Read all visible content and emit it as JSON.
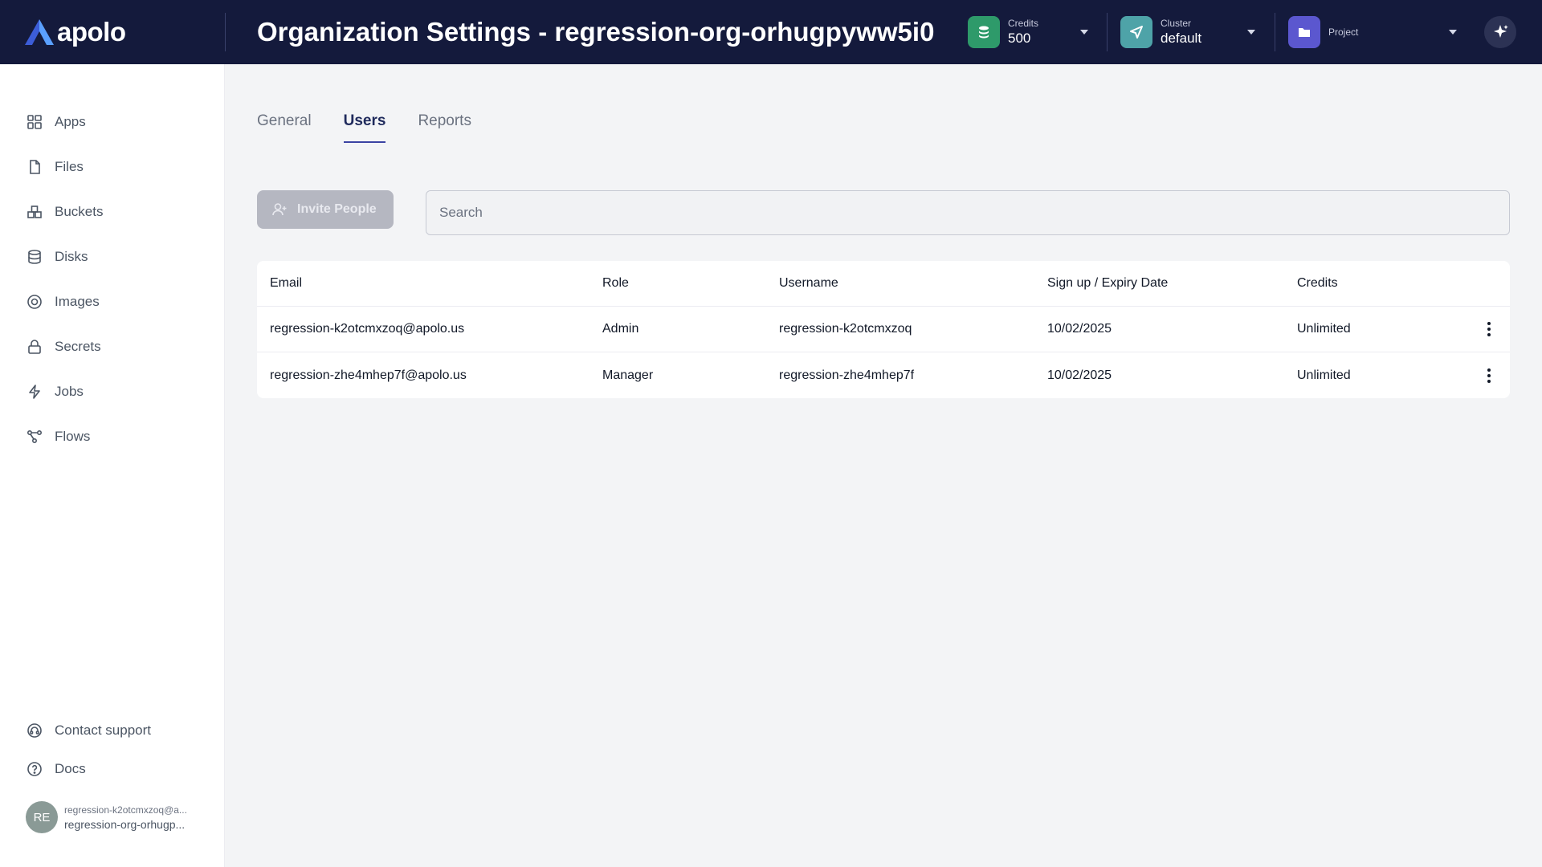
{
  "app": {
    "name": "apolo"
  },
  "header": {
    "title": "Organization Settings - regression-org-orhugpyww5i0",
    "credits": {
      "caption": "Credits",
      "value": "500"
    },
    "cluster": {
      "caption": "Cluster",
      "value": "default"
    },
    "project": {
      "caption": "Project",
      "value": ""
    }
  },
  "sidebar": {
    "items": [
      {
        "label": "Apps",
        "icon": "grid-icon"
      },
      {
        "label": "Files",
        "icon": "file-icon"
      },
      {
        "label": "Buckets",
        "icon": "buckets-icon"
      },
      {
        "label": "Disks",
        "icon": "database-icon"
      },
      {
        "label": "Images",
        "icon": "image-icon"
      },
      {
        "label": "Secrets",
        "icon": "lock-icon"
      },
      {
        "label": "Jobs",
        "icon": "bolt-icon"
      },
      {
        "label": "Flows",
        "icon": "flows-icon"
      }
    ],
    "bottom": [
      {
        "label": "Contact support",
        "icon": "headset-icon"
      },
      {
        "label": "Docs",
        "icon": "help-icon"
      }
    ],
    "user": {
      "initials": "RE",
      "email": "regression-k2otcmxzoq@a...",
      "org": "regression-org-orhugp..."
    }
  },
  "tabs": [
    {
      "label": "General",
      "active": false
    },
    {
      "label": "Users",
      "active": true
    },
    {
      "label": "Reports",
      "active": false
    }
  ],
  "toolbar": {
    "invite_label": "Invite People",
    "search_placeholder": "Search"
  },
  "table": {
    "headers": [
      "Email",
      "Role",
      "Username",
      "Sign up / Expiry Date",
      "Credits"
    ],
    "rows": [
      [
        "regression-k2otcmxzoq@apolo.us",
        "Admin",
        "regression-k2otcmxzoq",
        "10/02/2025",
        "Unlimited"
      ],
      [
        "regression-zhe4mhep7f@apolo.us",
        "Manager",
        "regression-zhe4mhep7f",
        "10/02/2025",
        "Unlimited"
      ]
    ]
  },
  "colors": {
    "header_bg": "#141a3c",
    "credits_icon_bg": "#2e9a6a",
    "cluster_icon_bg": "#4ea3a8",
    "project_icon_bg": "#5b57cf",
    "active_tab": "#3b43a3"
  }
}
